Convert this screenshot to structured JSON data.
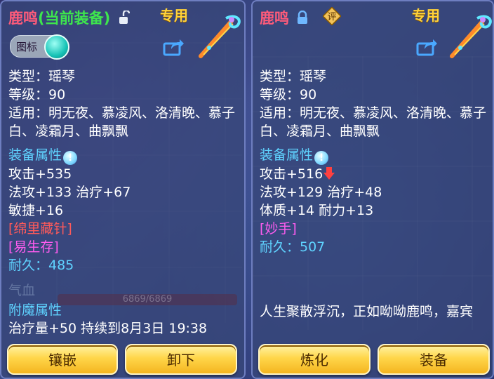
{
  "left": {
    "name": "鹿鸣",
    "equipped_tag": "(当前装备)",
    "special_label": "专用",
    "toggle_label": "图标",
    "type": "类型：瑶琴",
    "level": "等级：90",
    "usable": "适用：明无夜、慕凌风、洛清晚、慕子白、凌霜月、曲飘飘",
    "attr_header": "装备属性",
    "attr_icon": "!",
    "attack": "攻击+535",
    "line2": "法攻+133 治疗+67",
    "line3": "敏捷+16",
    "skill1": "[绵里藏针]",
    "skill2": "[易生存]",
    "durability": "耐久：485",
    "faded_label": "气血",
    "faded_value": "6869/6869",
    "enchant_header": "附魔属性",
    "enchant_line": "治疗量+50 持续到8月3日 19:38"
  },
  "right": {
    "name": "鹿鸣",
    "eval_badge": "评",
    "special_label": "专用",
    "type": "类型：瑶琴",
    "level": "等级：90",
    "usable": "适用：明无夜、慕凌风、洛清晚、慕子白、凌霜月、曲飘飘",
    "attr_header": "装备属性",
    "attr_icon": "!",
    "attack": "攻击+516",
    "line2": "法攻+129 治疗+48",
    "line3": "体质+14 耐力+13",
    "skill1": "[妙手]",
    "durability": "耐久：507",
    "description": "人生聚散浮沉，正如呦呦鹿鸣，嘉宾"
  },
  "buttons": {
    "inlay": "镶嵌",
    "unequip": "卸下",
    "refine": "炼化",
    "equip": "装备"
  },
  "colors": {
    "name": "#ff5b7a",
    "equipped": "#3ee64d",
    "special": "#ffd23a",
    "section": "#5fd3ff",
    "skill_red": "#ff5a5a",
    "skill_magenta": "#ff5cf0",
    "button": "#ffd64a"
  },
  "icons": {
    "lock_open": "unlock-icon",
    "lock_closed": "lock-icon",
    "share": "share-icon",
    "weapon": "zither-weapon-icon",
    "info": "info-icon",
    "down": "down-arrow-icon",
    "toggle": "toggle-switch"
  }
}
